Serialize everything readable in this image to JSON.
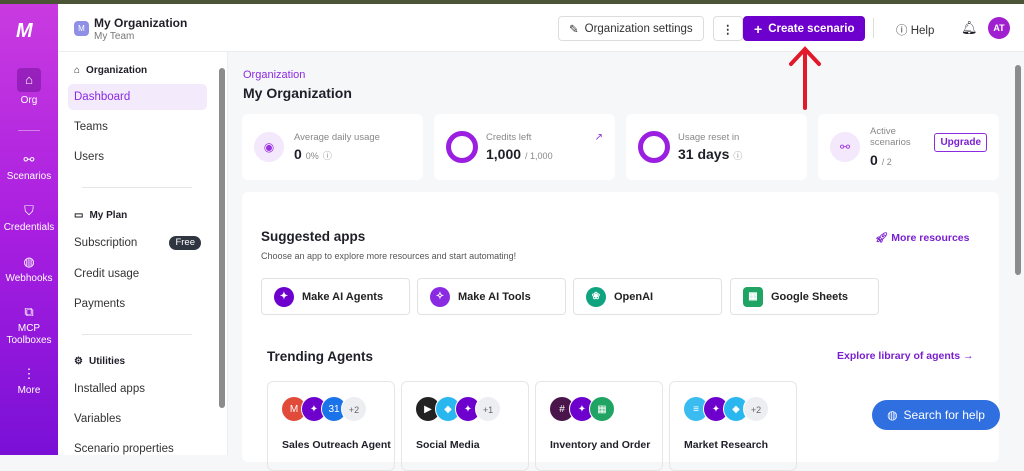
{
  "rail": {
    "items": [
      {
        "label": "Org",
        "icon": "home"
      },
      {
        "label": "Scenarios",
        "icon": "share"
      },
      {
        "label": "Credentials",
        "icon": "shield"
      },
      {
        "label": "Webhooks",
        "icon": "globe"
      },
      {
        "label": "MCP Toolboxes",
        "icon": "mcp"
      },
      {
        "label": "More",
        "icon": "dots"
      }
    ]
  },
  "org": {
    "avatar": "M",
    "name": "My Organization",
    "team": "My Team"
  },
  "sidebar": {
    "organization": "Organization",
    "dashboard": "Dashboard",
    "teams": "Teams",
    "users": "Users",
    "my_plan": "My Plan",
    "subscription": "Subscription",
    "free_badge": "Free",
    "credit_usage": "Credit usage",
    "payments": "Payments",
    "utilities": "Utilities",
    "installed_apps": "Installed apps",
    "variables": "Variables",
    "scenario_properties": "Scenario properties"
  },
  "header": {
    "org_settings": "Organization settings",
    "create_scenario": "Create scenario",
    "help": "Help",
    "avatar": "AT"
  },
  "main": {
    "breadcrumb": "Organization",
    "title": "My Organization",
    "stats": {
      "avg_label": "Average daily usage",
      "avg_value": "0",
      "avg_pct": "0%",
      "credits_label": "Credits left",
      "credits_value": "1,000",
      "credits_total": "/ 1,000",
      "reset_label": "Usage reset in",
      "reset_value": "31 days",
      "active_label": "Active scenarios",
      "active_value": "0",
      "active_total": "/ 2",
      "upgrade": "Upgrade"
    },
    "suggested": {
      "title": "Suggested apps",
      "subtitle": "Choose an app to explore more resources and start automating!",
      "more": "More resources",
      "apps": [
        "Make AI Agents",
        "Make AI Tools",
        "OpenAI",
        "Google Sheets"
      ]
    },
    "trending": {
      "title": "Trending Agents",
      "explore": "Explore library of agents →",
      "agents": [
        {
          "name": "Sales Outreach Agent",
          "more": "+2"
        },
        {
          "name": "Social Media",
          "more": "+1"
        },
        {
          "name": "Inventory and Order",
          "more": ""
        },
        {
          "name": "Market Research",
          "more": "+2"
        }
      ]
    },
    "search_help": "Search for help"
  },
  "colors": {
    "accent": "#6d00cc",
    "link": "#7a1fd0",
    "help_button": "#2f6fe0"
  }
}
